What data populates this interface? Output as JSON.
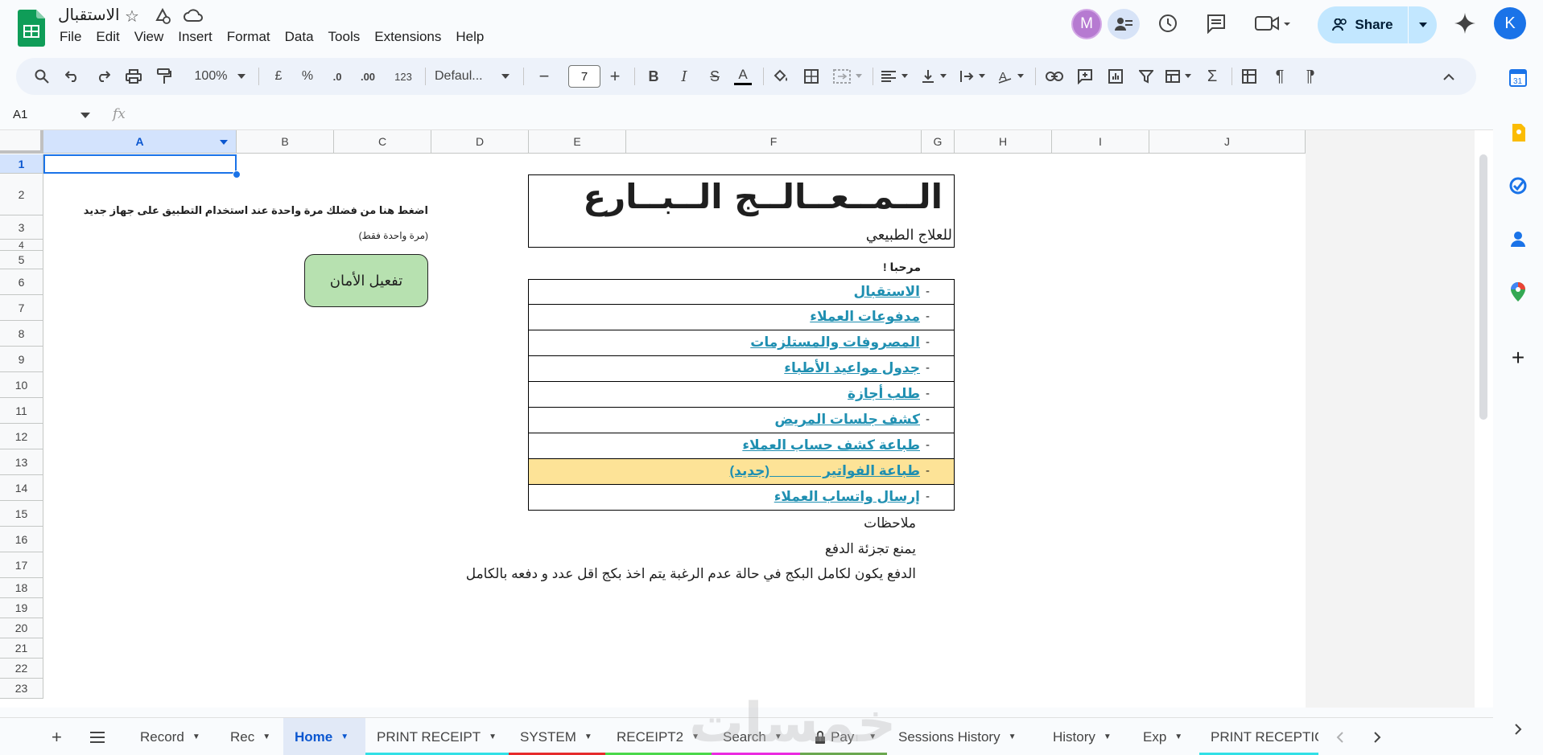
{
  "doc": {
    "title": "الاستقبال"
  },
  "menu": [
    "File",
    "Edit",
    "View",
    "Insert",
    "Format",
    "Data",
    "Tools",
    "Extensions",
    "Help"
  ],
  "header": {
    "avatar_m": "M",
    "share_label": "Share",
    "avatar_k": "K"
  },
  "toolbar": {
    "zoom": "100%",
    "currency": "£",
    "percent": "%",
    "dec_less": ".0",
    "dec_more": ".00",
    "format_123": "123",
    "font": "Defaul...",
    "font_size": "7"
  },
  "formula_bar": {
    "cell_ref": "A1",
    "fx": "fx"
  },
  "columns": [
    "A",
    "B",
    "C",
    "D",
    "E",
    "F",
    "G",
    "H",
    "I",
    "J"
  ],
  "rows": [
    "1",
    "2",
    "3",
    "4",
    "5",
    "6",
    "7",
    "8",
    "9",
    "10",
    "11",
    "12",
    "13",
    "14",
    "15",
    "16",
    "17",
    "18",
    "19",
    "20",
    "21",
    "22",
    "23"
  ],
  "sheet": {
    "activate_instruction": "اضغط هنا من فضلك مرة واحدة عند استخدام التطبيق على جهاز جديد",
    "activate_note": "(مرة واحدة فقط)",
    "activate_button": "تفعيل الأمان",
    "main_title": "الــمــعــالــج الــبــارع",
    "subtitle": "للعلاج الطبيعي",
    "welcome": "مرحبا !",
    "links": [
      {
        "label": "الاستقبال",
        "highlight": false
      },
      {
        "label": "مدفوعات العملاء",
        "highlight": false
      },
      {
        "label": "المصروفات والمستلزمات",
        "highlight": false
      },
      {
        "label": "جدول مواعيد الأطباء",
        "highlight": false
      },
      {
        "label": "طلب أجازة",
        "highlight": false
      },
      {
        "label": "كشف جلسات المريض",
        "highlight": false
      },
      {
        "label": "طباعة كشف حساب العملاء",
        "highlight": false
      },
      {
        "label": "طباعة الفواتير              (جديد)",
        "highlight": true
      },
      {
        "label": "إرسال واتساب العملاء",
        "highlight": false
      }
    ],
    "link_dash": "-",
    "notes_title": "ملاحظات",
    "note1": "يمنع تجزئة الدفع",
    "note2": "الدفع يكون لكامل البكج في حالة عدم الرغبة يتم اخذ بكج اقل عدد و دفعه بالكامل"
  },
  "watermark": "خمسات",
  "tabs": [
    {
      "label": "Record",
      "active": false,
      "color": ""
    },
    {
      "label": "Rec",
      "active": false,
      "color": ""
    },
    {
      "label": "Home",
      "active": true,
      "color": ""
    },
    {
      "label": "PRINT RECEIPT",
      "active": false,
      "color": "#32e0e6"
    },
    {
      "label": "SYSTEM",
      "active": false,
      "color": "#e52b2b"
    },
    {
      "label": "RECEIPT2",
      "active": false,
      "color": "#4ad84a"
    },
    {
      "label": "Search",
      "active": false,
      "color": "#ea2be0"
    },
    {
      "label": "Pay",
      "active": false,
      "color": "#6aa84f",
      "locked": true
    },
    {
      "label": "Sessions History",
      "active": false,
      "color": ""
    },
    {
      "label": "History",
      "active": false,
      "color": ""
    },
    {
      "label": "Exp",
      "active": false,
      "color": ""
    },
    {
      "label": "PRINT RECEPTIC",
      "active": false,
      "color": "#32e0e6"
    }
  ],
  "colors": {
    "link": "#1f8fb1",
    "highlight_row": "#fde397",
    "button_fill": "#b7e1b0",
    "selection": "#1a73e8"
  }
}
